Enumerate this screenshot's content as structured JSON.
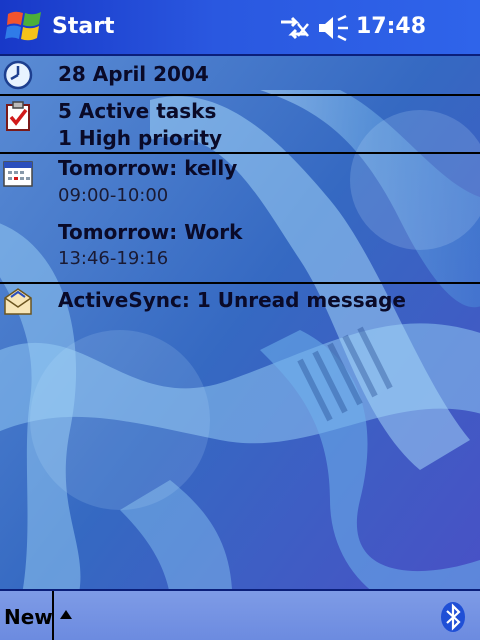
{
  "titlebar": {
    "start_label": "Start",
    "clock": "17:48",
    "icons": [
      "windows-flag-icon",
      "connectivity-icon",
      "volume-icon"
    ]
  },
  "today": {
    "date": {
      "label": "28 April 2004",
      "icon": "clock-icon"
    },
    "tasks": {
      "line1": "5 Active tasks",
      "line2": "1 High priority",
      "icon": "tasks-icon"
    },
    "calendar": {
      "icon": "calendar-icon",
      "appointments": [
        {
          "title": "Tomorrow: kelly",
          "time": "09:00-10:00"
        },
        {
          "title": "Tomorrow: Work",
          "time": "13:46-19:16"
        }
      ]
    },
    "messages": {
      "label": "ActiveSync: 1 Unread message",
      "icon": "envelope-icon"
    }
  },
  "menubar": {
    "new_label": "New",
    "icons": [
      "up-arrow-icon",
      "bluetooth-icon"
    ]
  },
  "colors": {
    "titlebar": "#2a58e0",
    "menubar": "#7e9be6",
    "wallpaper_base": "#2f5fb8"
  }
}
